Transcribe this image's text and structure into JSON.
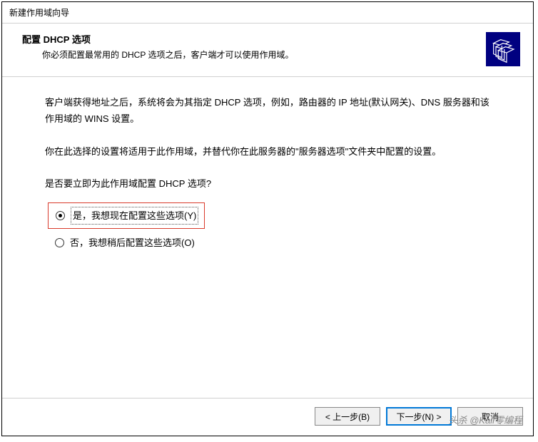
{
  "window": {
    "title": "新建作用域向导"
  },
  "header": {
    "title": "配置 DHCP 选项",
    "description": "你必须配置最常用的 DHCP 选项之后，客户端才可以使用作用域。"
  },
  "body": {
    "para1": "客户端获得地址之后，系统将会为其指定 DHCP 选项，例如，路由器的 IP 地址(默认网关)、DNS 服务器和该作用域的 WINS 设置。",
    "para2": "你在此选择的设置将适用于此作用域，并替代你在此服务器的\"服务器选项\"文件夹中配置的设置。",
    "question": "是否要立即为此作用域配置 DHCP 选项?",
    "options": {
      "yes": "是，我想现在配置这些选项(Y)",
      "no": "否，我想稍后配置这些选项(O)"
    }
  },
  "footer": {
    "back": "< 上一步(B)",
    "next": "下一步(N) >",
    "cancel": "取消"
  },
  "watermark": "头杀 @Kali零编程"
}
